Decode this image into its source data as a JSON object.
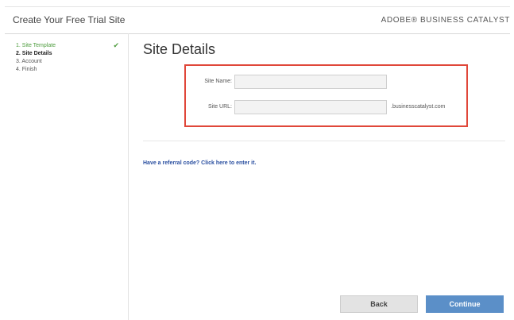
{
  "header": {
    "title": "Create Your Free Trial Site",
    "brand": "ADOBE® BUSINESS CATALYST"
  },
  "sidebar": {
    "steps": [
      {
        "label": "1. Site Template",
        "state": "done"
      },
      {
        "label": "2. Site Details",
        "state": "current"
      },
      {
        "label": "3. Account",
        "state": "future"
      },
      {
        "label": "4. Finish",
        "state": "future"
      }
    ]
  },
  "main": {
    "title": "Site Details",
    "site_name_label": "Site Name:",
    "site_name_value": "",
    "site_url_label": "Site URL:",
    "site_url_value": "",
    "url_suffix": ".businesscatalyst.com",
    "referral_link": "Have a referral code? Click here to enter it.",
    "back_label": "Back",
    "continue_label": "Continue"
  },
  "colors": {
    "highlight_border": "#e0473a",
    "done_step": "#4f9d3f",
    "continue_button": "#5b8fc8",
    "link": "#2a4fa0"
  },
  "icons": {
    "step_done": "check-icon"
  }
}
